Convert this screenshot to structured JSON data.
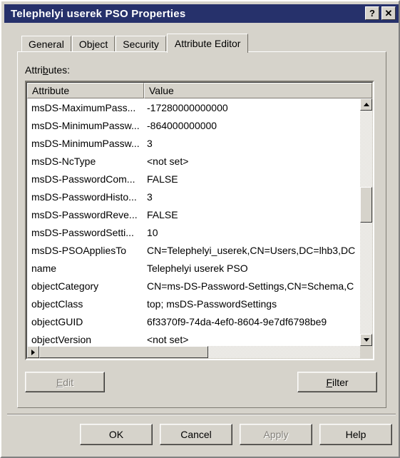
{
  "window": {
    "title": "Telephelyi userek PSO Properties",
    "help_button": "?",
    "close_button": "✕"
  },
  "tabs": [
    {
      "label": "General",
      "selected": false
    },
    {
      "label": "Object",
      "selected": false
    },
    {
      "label": "Security",
      "selected": false
    },
    {
      "label": "Attribute Editor",
      "selected": true
    }
  ],
  "attributes_panel": {
    "label_prefix": "Attri",
    "label_accel": "b",
    "label_suffix": "utes:",
    "columns": {
      "attribute": "Attribute",
      "value": "Value"
    },
    "rows": [
      {
        "attribute": "msDS-MaximumPass...",
        "value": "-17280000000000"
      },
      {
        "attribute": "msDS-MinimumPassw...",
        "value": "-864000000000"
      },
      {
        "attribute": "msDS-MinimumPassw...",
        "value": "3"
      },
      {
        "attribute": "msDS-NcType",
        "value": "<not set>"
      },
      {
        "attribute": "msDS-PasswordCom...",
        "value": "FALSE"
      },
      {
        "attribute": "msDS-PasswordHisto...",
        "value": "3"
      },
      {
        "attribute": "msDS-PasswordReve...",
        "value": "FALSE"
      },
      {
        "attribute": "msDS-PasswordSetti...",
        "value": "10"
      },
      {
        "attribute": "msDS-PSOAppliesTo",
        "value": "CN=Telephelyi_userek,CN=Users,DC=lhb3,DC"
      },
      {
        "attribute": "name",
        "value": "Telephelyi userek PSO"
      },
      {
        "attribute": "objectCategory",
        "value": "CN=ms-DS-Password-Settings,CN=Schema,C"
      },
      {
        "attribute": "objectClass",
        "value": "top; msDS-PasswordSettings"
      },
      {
        "attribute": "objectGUID",
        "value": "6f3370f9-74da-4ef0-8604-9e7df6798be9"
      },
      {
        "attribute": "objectVersion",
        "value": "<not set>"
      }
    ],
    "edit_button": {
      "prefix": "",
      "accel": "E",
      "suffix": "dit",
      "enabled": false
    },
    "filter_button": {
      "prefix": "",
      "accel": "F",
      "suffix": "ilter",
      "enabled": true
    }
  },
  "footer": {
    "ok": "OK",
    "cancel": "Cancel",
    "apply": "Apply",
    "help": "Help"
  }
}
